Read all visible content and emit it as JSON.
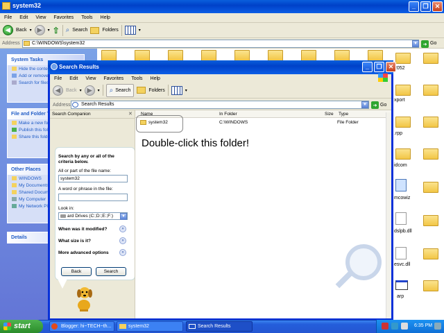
{
  "back_window": {
    "title": "system32",
    "menu": [
      "File",
      "Edit",
      "View",
      "Favorites",
      "Tools",
      "Help"
    ],
    "toolbar": {
      "back": "Back",
      "search": "Search",
      "folders": "Folders"
    },
    "address_label": "Address",
    "address_value": "C:\\WINDOWS\\system32",
    "go": "Go",
    "tasks": {
      "system_tasks": {
        "title": "System Tasks",
        "items": [
          "Hide the contents of this folder",
          "Add or remove programs",
          "Search for files or folders"
        ]
      },
      "file_folder_tasks": {
        "title": "File and Folder Tasks",
        "items": [
          "Make a new folder",
          "Publish this folder to the Web",
          "Share this folder"
        ]
      },
      "other_places": {
        "title": "Other Places",
        "items": [
          "WINDOWS",
          "My Documents",
          "Shared Documents",
          "My Computer",
          "My Network Places"
        ]
      },
      "details": {
        "title": "Details"
      }
    },
    "right_labels": [
      "2052",
      "xport",
      ".rpp",
      "idcom",
      "mcowiz",
      "dslpb.dll",
      "esvc.dll",
      "arp"
    ]
  },
  "search_window": {
    "title": "Search Results",
    "menu": [
      "File",
      "Edit",
      "View",
      "Favorites",
      "Tools",
      "Help"
    ],
    "toolbar": {
      "back": "Back",
      "search": "Search",
      "folders": "Folders"
    },
    "address_label": "Address",
    "address_value": "Search Results",
    "go": "Go",
    "companion": {
      "header": "Search Companion",
      "heading": "Search by any or all of the criteria below.",
      "name_label": "All or part of the file name:",
      "name_value": "system32",
      "phrase_label": "A word or phrase in the file:",
      "phrase_value": "",
      "lookin_label": "Look in:",
      "lookin_value": "ard Drives (C:;D:;E:;F:)",
      "options": [
        "When was it modified?",
        "What size is it?",
        "More advanced options"
      ],
      "back_btn": "Back",
      "search_btn": "Search"
    },
    "columns": [
      "Name",
      "In Folder",
      "Size",
      "Type"
    ],
    "results": [
      {
        "name": "system32",
        "folder": "C:\\WINDOWS",
        "size": "",
        "type": "File Folder"
      }
    ],
    "annotation": "Double-click this folder!"
  },
  "taskbar": {
    "start": "start",
    "tasks": [
      "Blogger: hi~TECH~th...",
      "system32",
      "Search Results"
    ],
    "clock": "6:35 PM"
  }
}
